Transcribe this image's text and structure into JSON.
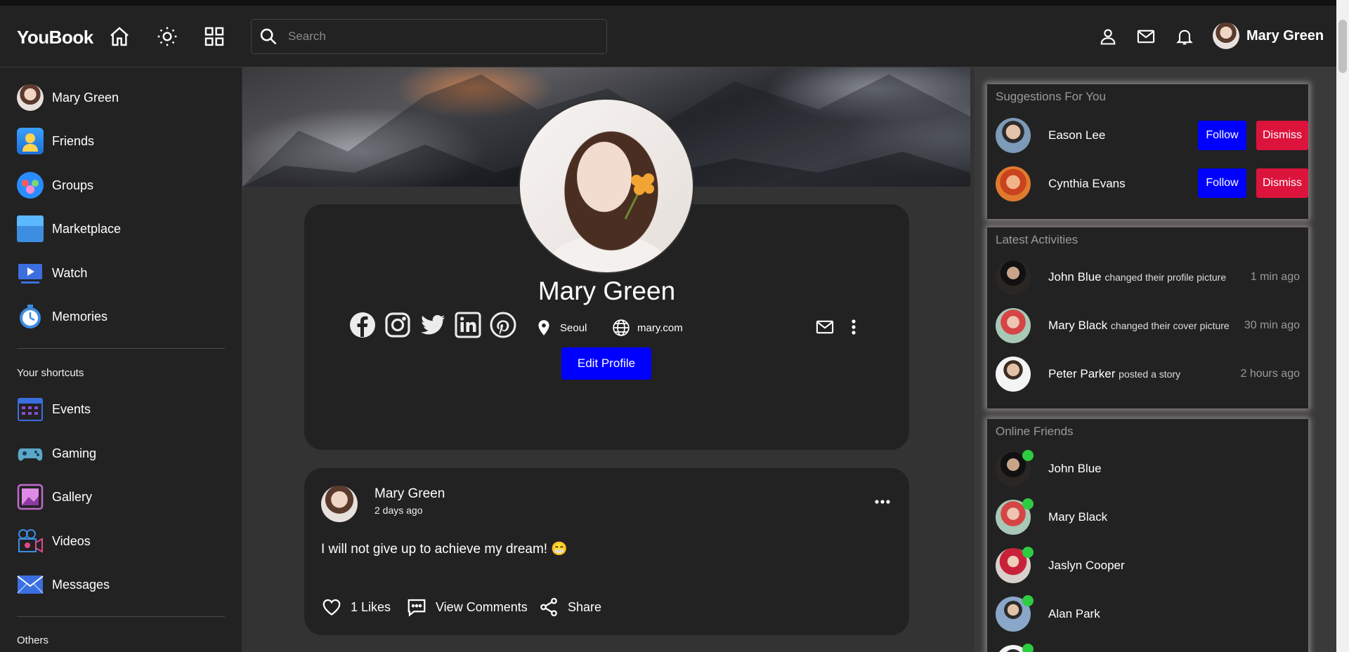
{
  "app": {
    "name": "YouBook"
  },
  "search": {
    "placeholder": "Search"
  },
  "user": {
    "name": "Mary Green"
  },
  "sidebar": {
    "items": [
      {
        "label": "Mary Green",
        "icon": "avatar"
      },
      {
        "label": "Friends",
        "icon": "friends-icon"
      },
      {
        "label": "Groups",
        "icon": "groups-icon"
      },
      {
        "label": "Marketplace",
        "icon": "marketplace-icon"
      },
      {
        "label": "Watch",
        "icon": "watch-icon"
      },
      {
        "label": "Memories",
        "icon": "memories-icon"
      }
    ],
    "shortcuts_title": "Your shortcuts",
    "shortcuts": [
      {
        "label": "Events",
        "icon": "events-icon"
      },
      {
        "label": "Gaming",
        "icon": "gaming-icon"
      },
      {
        "label": "Gallery",
        "icon": "gallery-icon"
      },
      {
        "label": "Videos",
        "icon": "videos-icon"
      },
      {
        "label": "Messages",
        "icon": "messages-icon"
      }
    ],
    "others_title": "Others"
  },
  "profile": {
    "name": "Mary Green",
    "location": "Seoul",
    "website": "mary.com",
    "edit_label": "Edit Profile",
    "socials": [
      "facebook-icon",
      "instagram-icon",
      "twitter-icon",
      "linkedin-icon",
      "pinterest-icon"
    ]
  },
  "post": {
    "author": "Mary Green",
    "time": "2 days ago",
    "text": "I will not give up to achieve my dream! 😁",
    "likes_label": "1 Likes",
    "comments_label": "View Comments",
    "share_label": "Share"
  },
  "suggestions": {
    "title": "Suggestions For You",
    "follow_label": "Follow",
    "dismiss_label": "Dismiss",
    "people": [
      {
        "name": "Eason Lee"
      },
      {
        "name": "Cynthia Evans"
      }
    ]
  },
  "activities": {
    "title": "Latest Activities",
    "items": [
      {
        "name": "John Blue",
        "action": "changed their profile picture",
        "time": "1 min ago"
      },
      {
        "name": "Mary Black",
        "action": "changed their cover picture",
        "time": "30 min ago"
      },
      {
        "name": "Peter Parker",
        "action": "posted a story",
        "time": "2 hours ago"
      }
    ]
  },
  "online": {
    "title": "Online Friends",
    "friends": [
      {
        "name": "John Blue"
      },
      {
        "name": "Mary Black"
      },
      {
        "name": "Jaslyn Cooper"
      },
      {
        "name": "Alan Park"
      }
    ]
  },
  "colors": {
    "accent": "#0000ff",
    "danger": "#dc143c",
    "online": "#2ecc40",
    "background": "#333333",
    "surface": "#222222"
  }
}
